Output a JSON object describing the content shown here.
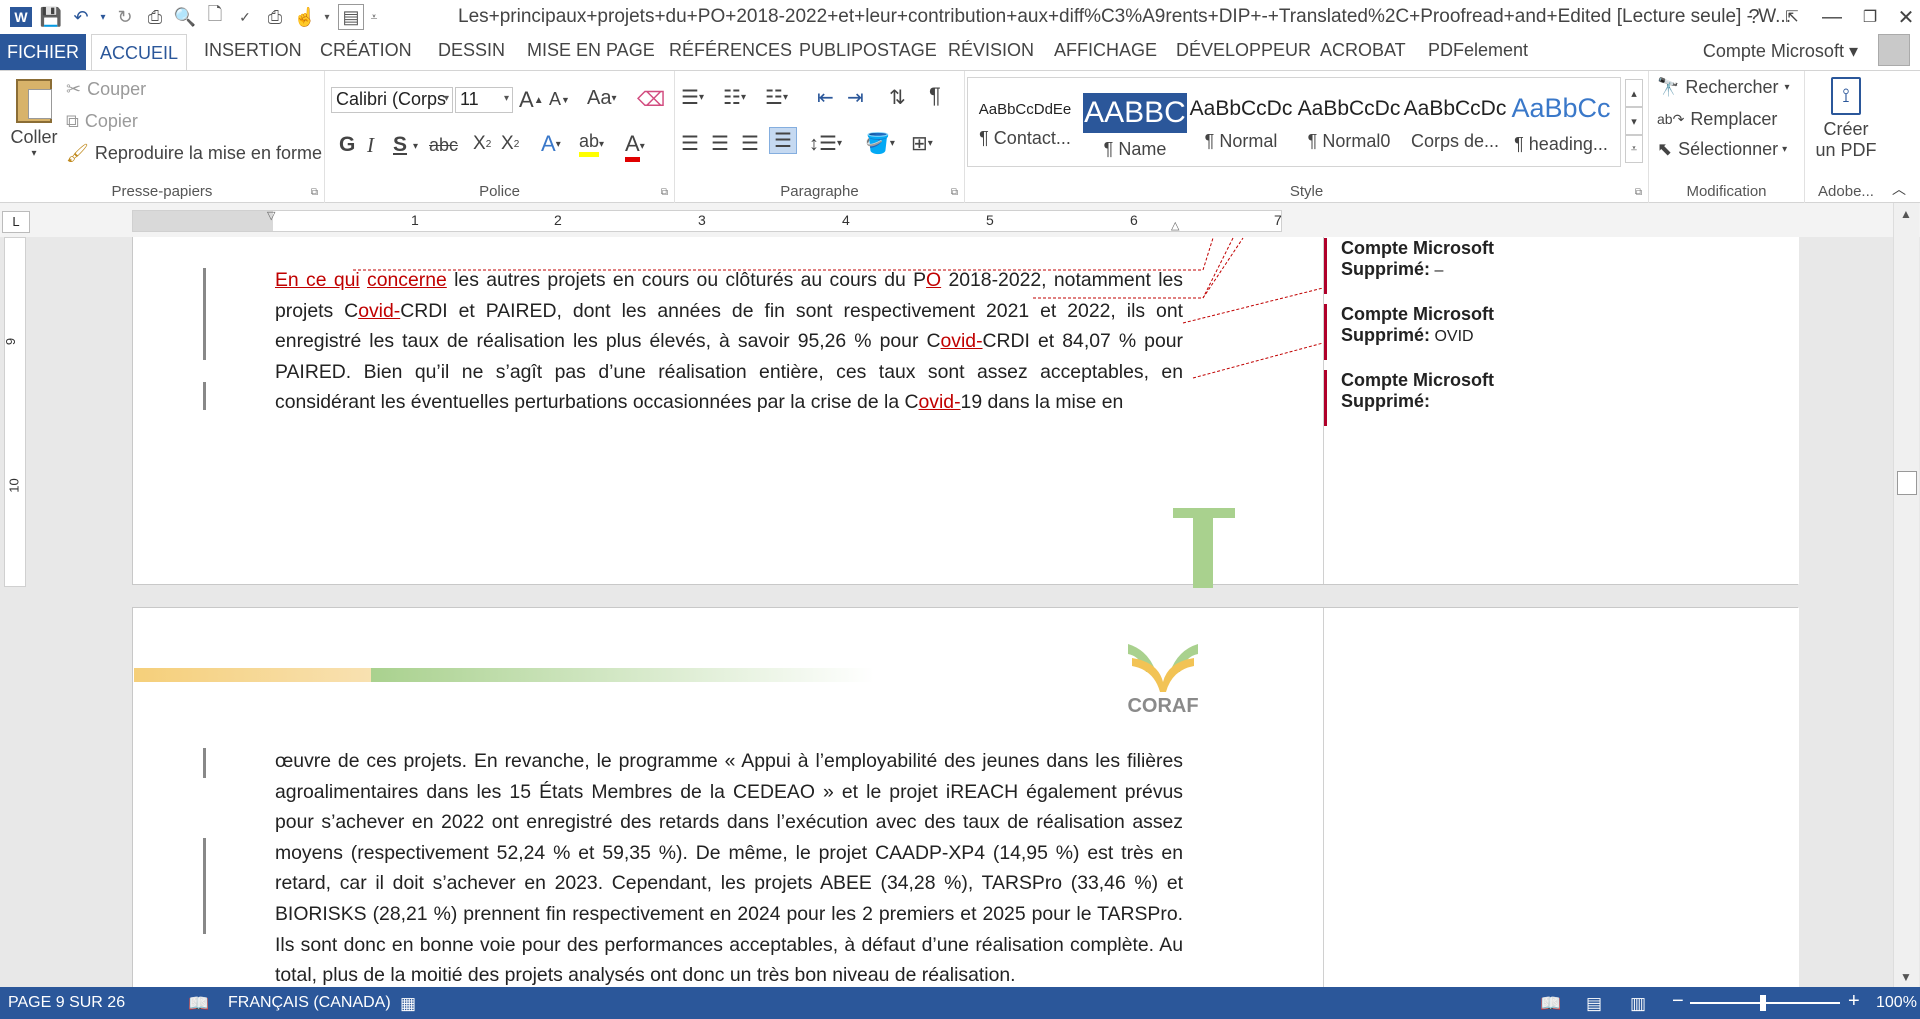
{
  "titlebar": {
    "title": "Les+principaux+projets+du+PO+2018-2022+et+leur+contribution+aux+diff%C3%A9rents+DIP+-+Translated%2C+Proofread+and+Edited [Lecture seule] - W...",
    "help": "?"
  },
  "tabs": [
    "FICHIER",
    "ACCUEIL",
    "INSERTION",
    "CRÉATION",
    "DESSIN",
    "MISE EN PAGE",
    "RÉFÉRENCES",
    "PUBLIPOSTAGE",
    "RÉVISION",
    "AFFICHAGE",
    "DÉVELOPPEUR",
    "ACROBAT",
    "PDFelement"
  ],
  "account": "Compte Microsoft",
  "ribbon": {
    "clipboard": {
      "paste": "Coller",
      "cut": "Couper",
      "copy": "Copier",
      "format_painter": "Reproduire la mise en forme",
      "label": "Presse-papiers"
    },
    "font": {
      "family": "Calibri (Corps",
      "size": "11",
      "case": "Aa",
      "bold": "G",
      "italic": "I",
      "underline": "S",
      "strike": "abc",
      "sub": "X",
      "sup": "X",
      "label": "Police"
    },
    "paragraph": {
      "label": "Paragraphe"
    },
    "styles": {
      "items": [
        {
          "sample": "AaBbCcDdEe",
          "name": "¶ Contact..."
        },
        {
          "sample": "AABBC",
          "name": "¶ Name"
        },
        {
          "sample": "AaBbCcDc",
          "name": "¶ Normal"
        },
        {
          "sample": "AaBbCcDc",
          "name": "¶ Normal0"
        },
        {
          "sample": "AaBbCcDc",
          "name": "Corps de..."
        },
        {
          "sample": "AaBbCc",
          "name": "¶ heading..."
        }
      ],
      "label": "Style"
    },
    "editing": {
      "find": "Rechercher",
      "replace": "Remplacer",
      "select": "Sélectionner",
      "label": "Modification"
    },
    "adobe": {
      "create_pdf_1": "Créer",
      "create_pdf_2": "un PDF",
      "label": "Adobe..."
    }
  },
  "ruler": {
    "numbers": [
      "1",
      "2",
      "3",
      "4",
      "5",
      "6",
      "7"
    ],
    "vertical": [
      "9",
      "10"
    ]
  },
  "page1": {
    "del1": "En ce qui",
    "del2": "concerne",
    "p1": " les autres projets en cours ou clôturés au cours du P",
    "del3": "O",
    "p2": " 2018-2022, notamment les projets C",
    "del4": "ovid-",
    "p3": "CRDI et PAIRED, dont les années de fin sont respectivement 2021 et 2022, ils ont enregistré les taux de réalisation les plus élevés, à savoir 95,26 % pour C",
    "del5": "ovid-",
    "p4": "CRDI et 84,07 % pour PAIRED. Bien qu’il ne s’agît pas d’une réalisation entière, ces taux sont assez acceptables, en considérant les éventuelles perturbations occasionnées par la crise de la C",
    "del6": "ovid-",
    "p5": "19 dans la mise en"
  },
  "comments": [
    {
      "author": "Compte Microsoft",
      "label": "Supprimé:",
      "text": " –"
    },
    {
      "author": "Compte Microsoft",
      "label": "Supprimé:",
      "text": " OVID"
    },
    {
      "author": "Compte Microsoft",
      "label": "Supprimé:",
      "text": ""
    }
  ],
  "page2": {
    "logo_text": "CORAF",
    "body": "œuvre de ces projets. En revanche, le programme « Appui à l’employabilité des jeunes dans les filières agroalimentaires dans les 15 États Membres de la CEDEAO » et le projet iREACH également prévus pour s’achever en 2022 ont enregistré des retards dans l’exécution avec des taux de réalisation assez moyens (respectivement 52,24 % et 59,35 %). De même, le projet CAADP-XP4 (14,95 %) est très en retard, car il doit s’achever en 2023. Cependant, les projets ABEE (34,28 %), TARSPro (33,46 %) et BIORISKS (28,21 %) prennent fin respectivement en 2024 pour les 2 premiers et 2025 pour le TARSPro. Ils sont donc en bonne voie pour des performances acceptables, à défaut d’une réalisation complète. Au total, plus de la moitié des projets analysés ont donc un très bon niveau de réalisation."
  },
  "statusbar": {
    "page": "PAGE 9 SUR 26",
    "language": "FRANÇAIS (CANADA)",
    "zoom": "100%",
    "zoom_minus": "−",
    "zoom_plus": "+"
  }
}
